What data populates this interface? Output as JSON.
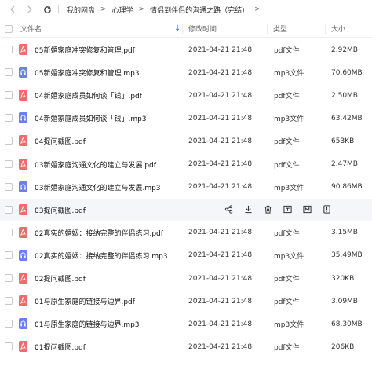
{
  "breadcrumb": {
    "items": [
      "我的网盘",
      "心理学",
      "情侣到伴侣的沟通之路（完结）"
    ],
    "separator": ">"
  },
  "columns": {
    "name": "文件名",
    "modified": "修改时间",
    "type": "类型",
    "size": "大小"
  },
  "files": [
    {
      "name": "05新婚家庭冲突修复和管理.pdf",
      "time": "2021-04-21 21:48",
      "type": "pdf文件",
      "size": "2.92MB",
      "kind": "pdf"
    },
    {
      "name": "05新婚家庭冲突修复和管理.mp3",
      "time": "2021-04-21 21:48",
      "type": "mp3文件",
      "size": "70.60MB",
      "kind": "mp3"
    },
    {
      "name": "04新婚家庭成员如何谈「钱」.pdf",
      "time": "2021-04-21 21:48",
      "type": "pdf文件",
      "size": "2.50MB",
      "kind": "pdf"
    },
    {
      "name": "04新婚家庭成员如何谈「钱」.mp3",
      "time": "2021-04-21 21:48",
      "type": "mp3文件",
      "size": "63.42MB",
      "kind": "mp3"
    },
    {
      "name": "04提问截图.pdf",
      "time": "2021-04-21 21:48",
      "type": "pdf文件",
      "size": "653KB",
      "kind": "pdf"
    },
    {
      "name": "03新婚家庭沟通文化的建立与发展.pdf",
      "time": "2021-04-21 21:48",
      "type": "pdf文件",
      "size": "2.47MB",
      "kind": "pdf"
    },
    {
      "name": "03新婚家庭沟通文化的建立与发展.mp3",
      "time": "2021-04-21 21:48",
      "type": "mp3文件",
      "size": "90.86MB",
      "kind": "mp3"
    },
    {
      "name": "03提问截图.pdf",
      "time": "",
      "type": "",
      "size": "",
      "kind": "pdf"
    },
    {
      "name": "02真实的婚姻：接纳完整的伴侣练习.pdf",
      "time": "2021-04-21 21:48",
      "type": "pdf文件",
      "size": "3.15MB",
      "kind": "pdf"
    },
    {
      "name": "02真实的婚姻：接纳完整的伴侣练习.mp3",
      "time": "2021-04-21 21:48",
      "type": "mp3文件",
      "size": "35.49MB",
      "kind": "mp3"
    },
    {
      "name": "02提问截图.pdf",
      "time": "2021-04-21 21:48",
      "type": "pdf文件",
      "size": "320KB",
      "kind": "pdf"
    },
    {
      "name": "01与原生家庭的链接与边界.pdf",
      "time": "2021-04-21 21:48",
      "type": "pdf文件",
      "size": "3.09MB",
      "kind": "pdf"
    },
    {
      "name": "01与原生家庭的链接与边界.mp3",
      "time": "2021-04-21 21:48",
      "type": "mp3文件",
      "size": "68.30MB",
      "kind": "mp3"
    },
    {
      "name": "01提问截图.pdf",
      "time": "2021-04-21 21:48",
      "type": "pdf文件",
      "size": "206KB",
      "kind": "pdf"
    }
  ],
  "hover_row_index": 7,
  "hover_actions": [
    "share-icon",
    "download-icon",
    "delete-icon",
    "rename-icon",
    "move-icon",
    "more-icon"
  ],
  "colors": {
    "pdf": "#f26a6a",
    "mp3": "#6c7ff0",
    "accent": "#2a72ff"
  }
}
